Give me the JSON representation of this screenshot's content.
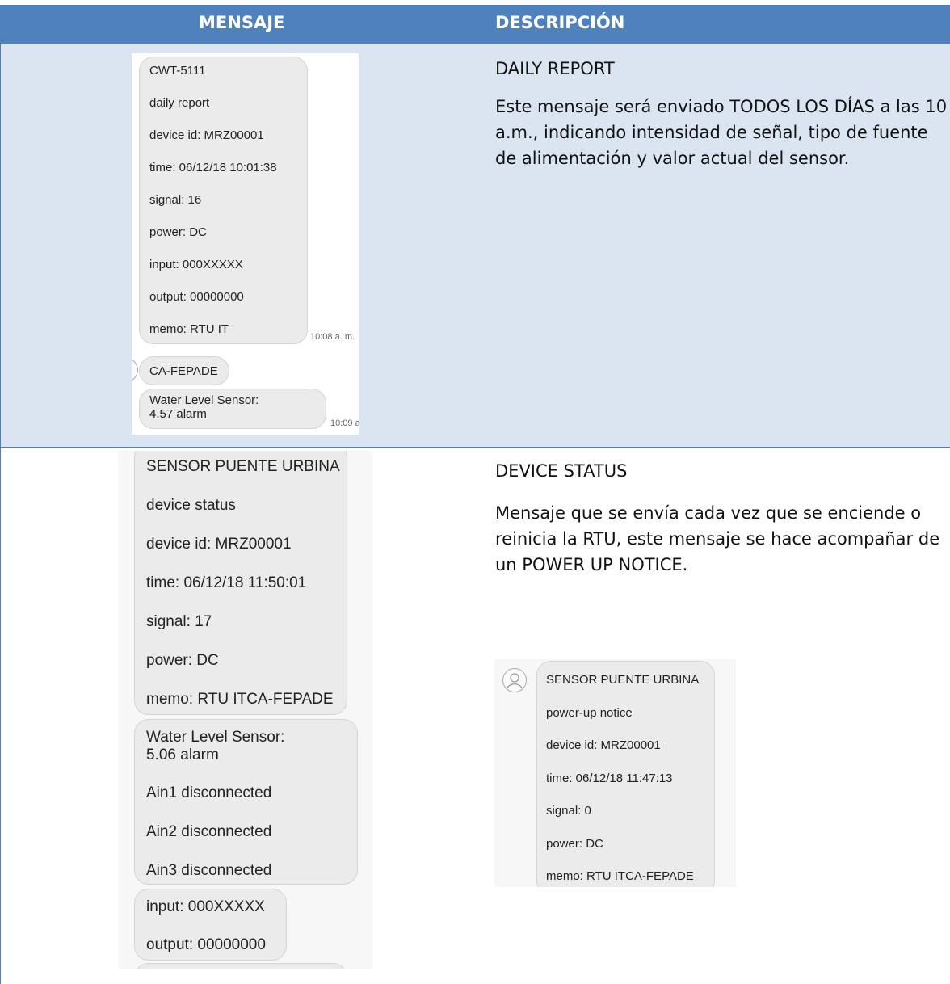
{
  "header": {
    "col1": "MENSAJE",
    "col2": "DESCRIPCIÓN"
  },
  "rows": [
    {
      "title": "DAILY REPORT",
      "description": "Este mensaje será enviado TODOS LOS DÍAS a las 10 a.m., indicando intensidad de señal, tipo de fuente de alimentación y valor actual del sensor.",
      "sms": {
        "bubble1_lines": [
          "CWT-5111",
          "daily report",
          "device id: MRZ00001",
          "time: 06/12/18 10:01:38",
          "signal: 16",
          "power: DC",
          "input: 000XXXXX",
          "output: 00000000",
          "memo: RTU IT"
        ],
        "time1": "10:08 a. m.",
        "bubble2": "CA-FEPADE",
        "bubble3_lines": [
          "Water Level Sensor:",
          "4.57 alarm"
        ],
        "time2": "10:09 a"
      }
    },
    {
      "title": "DEVICE STATUS",
      "description": "Mensaje que se envía cada vez que se enciende o reinicia la RTU, este mensaje se hace acompañar de un POWER UP NOTICE.",
      "sms": {
        "bubble1_lines": [
          "SENSOR PUENTE URBINA",
          "device status",
          "device id: MRZ00001",
          "time: 06/12/18 11:50:01",
          "signal: 17",
          "power: DC",
          "memo: RTU ITCA-FEPADE"
        ],
        "bubble2_lines": [
          "Water Level Sensor:",
          "5.06 alarm",
          "Ain1 disconnected",
          "Ain2 disconnected",
          "Ain3 disconnected"
        ],
        "bubble3_lines": [
          "input: 000XXXXX",
          "output: 00000000"
        ]
      },
      "notice": {
        "lines": [
          "SENSOR PUENTE URBINA",
          "power-up notice",
          "device id: MRZ00001",
          "time: 06/12/18 11:47:13",
          "signal: 0",
          "power: DC",
          "memo: RTU ITCA-FEPADE"
        ],
        "avatar_icon": "person-outline-icon"
      }
    }
  ]
}
